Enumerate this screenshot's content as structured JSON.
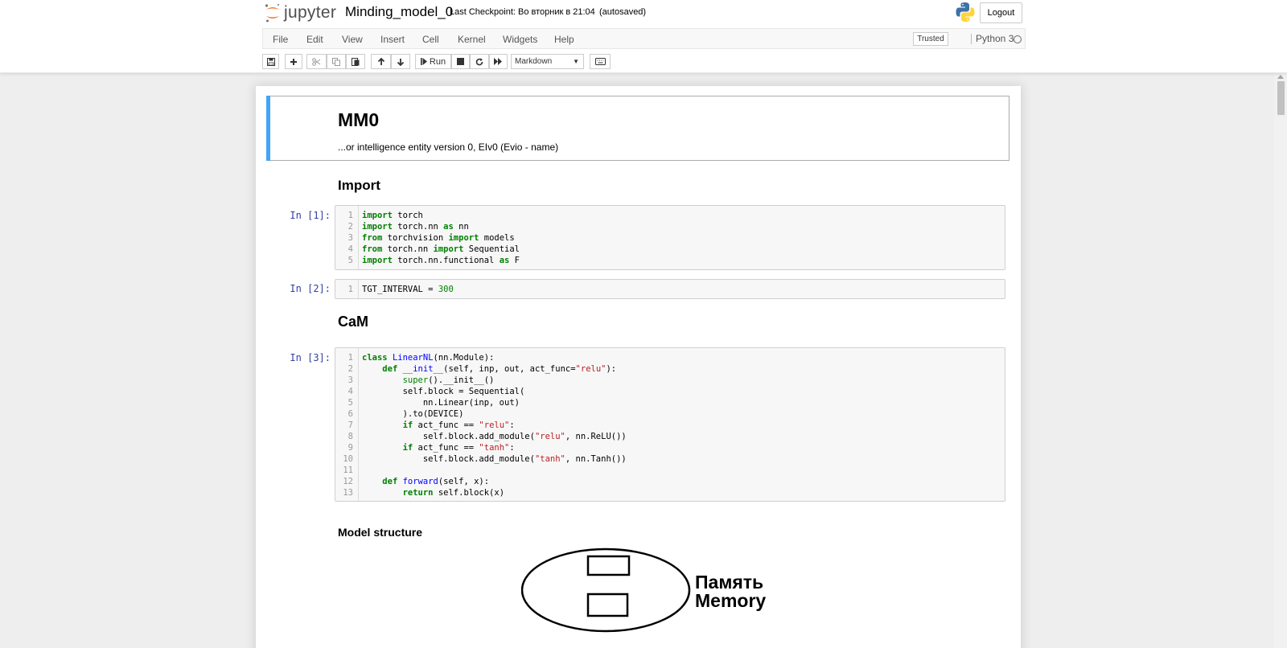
{
  "header": {
    "logo_text": "jupyter",
    "notebook_name": "Minding_model_0",
    "checkpoint": "Last Checkpoint: Во вторник в 21:04",
    "autosave": "(autosaved)",
    "logout_label": "Logout"
  },
  "menubar": {
    "items": [
      "File",
      "Edit",
      "View",
      "Insert",
      "Cell",
      "Kernel",
      "Widgets",
      "Help"
    ],
    "trusted": "Trusted",
    "kernel_name": "Python 3"
  },
  "toolbar": {
    "run_label": "Run",
    "cell_type": "Markdown"
  },
  "notebook": {
    "title": "MM0",
    "subtitle": "...or intelligence entity version 0, EIv0 (Evio - name)",
    "import_heading": "Import",
    "cam_heading": "CaM",
    "model_structure_heading": "Model structure",
    "cells": [
      {
        "prompt": "In [1]:",
        "lines": [
          [
            [
              "import",
              "kw"
            ],
            [
              " torch",
              ""
            ]
          ],
          [
            [
              "import",
              "kw"
            ],
            [
              " torch.nn ",
              ""
            ],
            [
              "as",
              "kw"
            ],
            [
              " nn",
              ""
            ]
          ],
          [
            [
              "from",
              "kw"
            ],
            [
              " torchvision ",
              ""
            ],
            [
              "import",
              "kw"
            ],
            [
              " models",
              ""
            ]
          ],
          [
            [
              "from",
              "kw"
            ],
            [
              " torch.nn ",
              ""
            ],
            [
              "import",
              "kw"
            ],
            [
              " Sequential",
              ""
            ]
          ],
          [
            [
              "import",
              "kw"
            ],
            [
              " torch.nn.functional ",
              ""
            ],
            [
              "as",
              "kw"
            ],
            [
              " F",
              ""
            ]
          ]
        ]
      },
      {
        "prompt": "In [2]:",
        "lines": [
          [
            [
              "TGT_INTERVAL = ",
              ""
            ],
            [
              "300",
              "nm"
            ]
          ]
        ]
      },
      {
        "prompt": "In [3]:",
        "lines": [
          [
            [
              "class",
              "kw"
            ],
            [
              " ",
              ""
            ],
            [
              "LinearNL",
              "fn"
            ],
            [
              "(nn.Module):",
              ""
            ]
          ],
          [
            [
              "    ",
              ""
            ],
            [
              "def",
              "kw"
            ],
            [
              " ",
              ""
            ],
            [
              "__init__",
              "fn"
            ],
            [
              "(self, inp, out, act_func=",
              ""
            ],
            [
              "\"relu\"",
              "st"
            ],
            [
              "):",
              ""
            ]
          ],
          [
            [
              "        ",
              ""
            ],
            [
              "super",
              "nm"
            ],
            [
              "().__init__()",
              ""
            ]
          ],
          [
            [
              "        self.block = Sequential(",
              ""
            ]
          ],
          [
            [
              "            nn.Linear(inp, out)",
              ""
            ]
          ],
          [
            [
              "        ).to(DEVICE)",
              ""
            ]
          ],
          [
            [
              "        ",
              ""
            ],
            [
              "if",
              "kw"
            ],
            [
              " act_func == ",
              ""
            ],
            [
              "\"relu\"",
              "st"
            ],
            [
              ":",
              ""
            ]
          ],
          [
            [
              "            self.block.add_module(",
              ""
            ],
            [
              "\"relu\"",
              "st"
            ],
            [
              ", nn.ReLU())",
              ""
            ]
          ],
          [
            [
              "        ",
              ""
            ],
            [
              "if",
              "kw"
            ],
            [
              " act_func == ",
              ""
            ],
            [
              "\"tanh\"",
              "st"
            ],
            [
              ":",
              ""
            ]
          ],
          [
            [
              "            self.block.add_module(",
              ""
            ],
            [
              "\"tanh\"",
              "st"
            ],
            [
              ", nn.Tanh())",
              ""
            ]
          ],
          [
            [
              "",
              ""
            ]
          ],
          [
            [
              "    ",
              ""
            ],
            [
              "def",
              "kw"
            ],
            [
              " ",
              ""
            ],
            [
              "forward",
              "fn"
            ],
            [
              "(self, x):",
              ""
            ]
          ],
          [
            [
              "        ",
              ""
            ],
            [
              "return",
              "kw"
            ],
            [
              " self.block(x)",
              ""
            ]
          ]
        ]
      }
    ],
    "diagram": {
      "label_ru": "Память",
      "label_en": "Memory"
    }
  },
  "colors": {
    "selected_cell_bar": "#42a5f5",
    "prompt": "#303f9f",
    "keyword": "#008000",
    "function_name": "#0000ff",
    "string": "#ba2121"
  }
}
